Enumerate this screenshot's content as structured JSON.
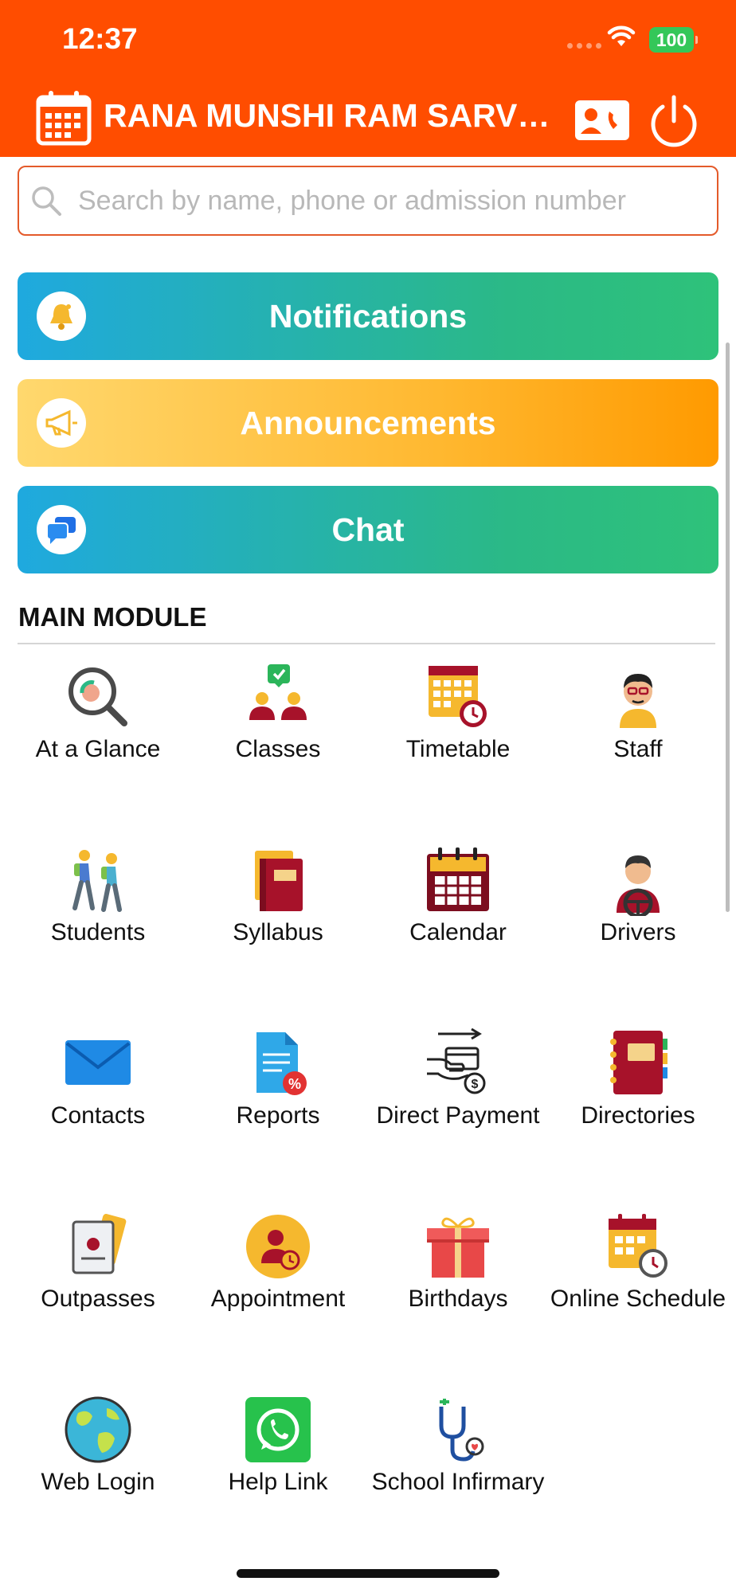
{
  "status_bar": {
    "time": "12:37",
    "battery": "100"
  },
  "header": {
    "school_name": "RANA MUNSHI RAM SARVHIT..."
  },
  "search": {
    "placeholder": "Search by name, phone or admission number"
  },
  "banners": {
    "notifications": "Notifications",
    "announcements": "Announcements",
    "chat": "Chat"
  },
  "main_module": {
    "title": "MAIN MODULE",
    "items": [
      {
        "label": "At a Glance",
        "icon": "magnifier-glance-icon"
      },
      {
        "label": "Classes",
        "icon": "classes-people-icon"
      },
      {
        "label": "Timetable",
        "icon": "timetable-clock-icon"
      },
      {
        "label": "Staff",
        "icon": "staff-person-icon"
      },
      {
        "label": "Students",
        "icon": "students-walking-icon"
      },
      {
        "label": "Syllabus",
        "icon": "books-icon"
      },
      {
        "label": "Calendar",
        "icon": "calendar-icon"
      },
      {
        "label": "Drivers",
        "icon": "driver-steering-icon"
      },
      {
        "label": "Contacts",
        "icon": "envelope-icon"
      },
      {
        "label": "Reports",
        "icon": "report-document-icon"
      },
      {
        "label": "Direct Payment",
        "icon": "payment-hand-card-icon"
      },
      {
        "label": "Directories",
        "icon": "notebook-directory-icon"
      },
      {
        "label": "Outpasses",
        "icon": "outpass-cards-icon"
      },
      {
        "label": "Appointment",
        "icon": "appointment-user-clock-icon"
      },
      {
        "label": "Birthdays",
        "icon": "gift-box-icon"
      },
      {
        "label": "Online Schedule",
        "icon": "schedule-calendar-clock-icon"
      },
      {
        "label": "Web Login",
        "icon": "globe-icon"
      },
      {
        "label": "Help Link",
        "icon": "whatsapp-icon"
      },
      {
        "label": "School Infirmary",
        "icon": "stethoscope-icon"
      }
    ]
  },
  "colors": {
    "header": "#ff4d00",
    "notifications_gradient": [
      "#1fa9df",
      "#2ec27a"
    ],
    "announcements_gradient": [
      "#ffd86e",
      "#ff9a00"
    ]
  }
}
